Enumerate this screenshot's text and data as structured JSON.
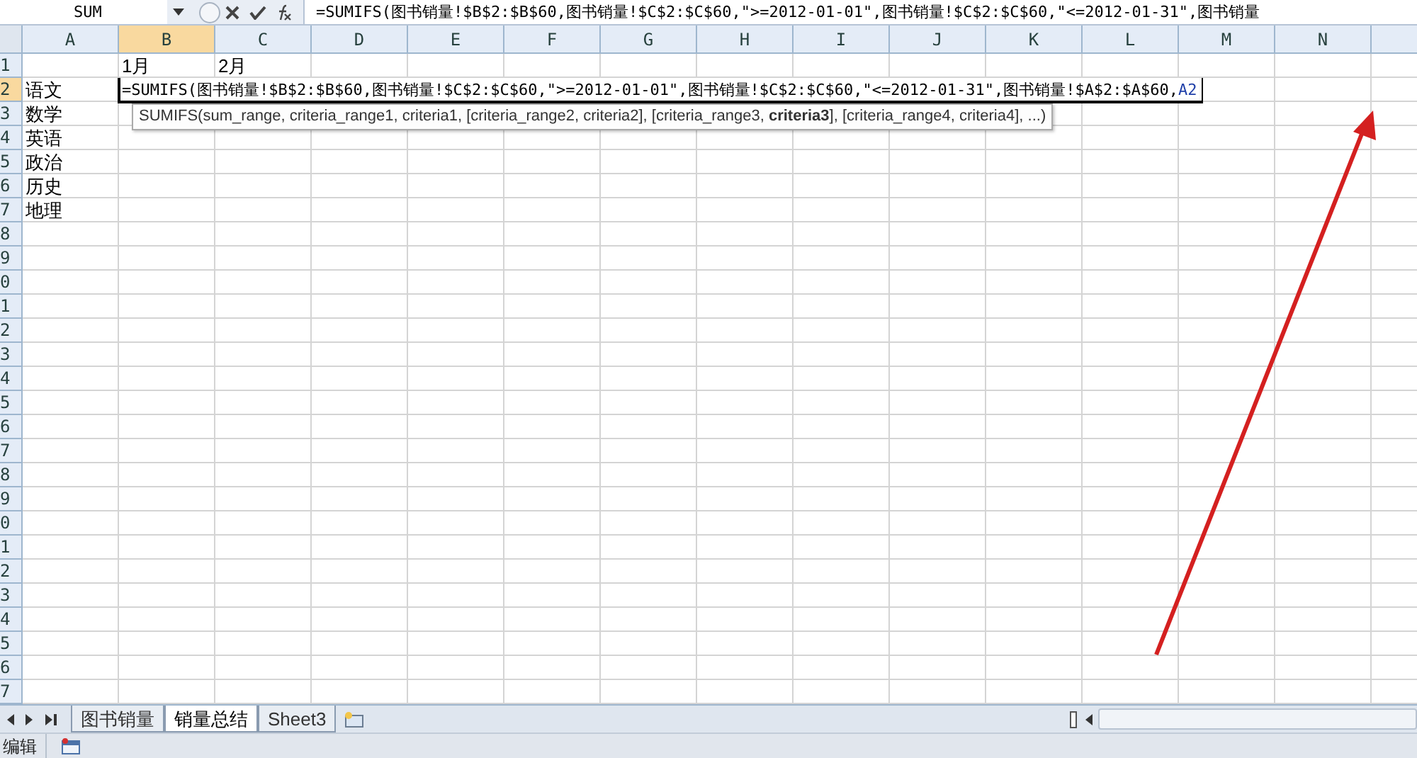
{
  "formula_bar": {
    "name_box": "SUM",
    "formula": "=SUMIFS(图书销量!$B$2:$B$60,图书销量!$C$2:$C$60,\">=2012-01-01\",图书销量!$C$2:$C$60,\"<=2012-01-31\",图书销量"
  },
  "columns": [
    {
      "label": "A",
      "selected": false
    },
    {
      "label": "B",
      "selected": true
    },
    {
      "label": "C",
      "selected": false
    },
    {
      "label": "D",
      "selected": false
    },
    {
      "label": "E",
      "selected": false
    },
    {
      "label": "F",
      "selected": false
    },
    {
      "label": "G",
      "selected": false
    },
    {
      "label": "H",
      "selected": false
    },
    {
      "label": "I",
      "selected": false
    },
    {
      "label": "J",
      "selected": false
    },
    {
      "label": "K",
      "selected": false
    },
    {
      "label": "L",
      "selected": false
    },
    {
      "label": "M",
      "selected": false
    },
    {
      "label": "N",
      "selected": false
    }
  ],
  "rows": [
    {
      "label": "1",
      "selected": false,
      "cells": {
        "B": "1月",
        "C": "2月"
      }
    },
    {
      "label": "2",
      "selected": true,
      "cells": {
        "A": "语文"
      }
    },
    {
      "label": "3",
      "selected": false,
      "cells": {
        "A": "数学"
      }
    },
    {
      "label": "4",
      "selected": false,
      "cells": {
        "A": "英语"
      }
    },
    {
      "label": "5",
      "selected": false,
      "cells": {
        "A": "政治"
      }
    },
    {
      "label": "6",
      "selected": false,
      "cells": {
        "A": "历史"
      }
    },
    {
      "label": "7",
      "selected": false,
      "cells": {
        "A": "地理"
      }
    },
    {
      "label": "8",
      "selected": false
    },
    {
      "label": "9",
      "selected": false
    },
    {
      "label": "0",
      "selected": false
    },
    {
      "label": "1",
      "selected": false
    },
    {
      "label": "2",
      "selected": false
    },
    {
      "label": "3",
      "selected": false
    },
    {
      "label": "4",
      "selected": false
    },
    {
      "label": "5",
      "selected": false
    },
    {
      "label": "6",
      "selected": false
    },
    {
      "label": "7",
      "selected": false
    },
    {
      "label": "8",
      "selected": false
    },
    {
      "label": "9",
      "selected": false
    },
    {
      "label": "0",
      "selected": false
    },
    {
      "label": "1",
      "selected": false
    },
    {
      "label": "2",
      "selected": false
    },
    {
      "label": "3",
      "selected": false
    },
    {
      "label": "4",
      "selected": false
    },
    {
      "label": "5",
      "selected": false
    },
    {
      "label": "6",
      "selected": false
    },
    {
      "label": "7",
      "selected": false
    }
  ],
  "cell_editor": {
    "parts": [
      {
        "kind": "plain",
        "text": "=SUMIFS(图书销量!$B$2:$B$60,图书销量!$C$2:$C$60,\">=2012-01-01\",图书销量!$C$2:$C$60,\"<=2012-01-31\",图书销量!$A$2:$A$60,"
      },
      {
        "kind": "reference",
        "text": "A2"
      }
    ]
  },
  "tooltip": "SUMIFS(sum_range, criteria_range1, criteria1, [criteria_range2, criteria2], [criteria_range3, **criteria3**], [criteria_range4, criteria4], ...)",
  "sheet_tabs": [
    {
      "label": "图书销量",
      "selected": false
    },
    {
      "label": "销量总结",
      "selected": true
    },
    {
      "label": "Sheet3",
      "selected": false
    }
  ],
  "status_bar": {
    "mode": "编辑"
  }
}
